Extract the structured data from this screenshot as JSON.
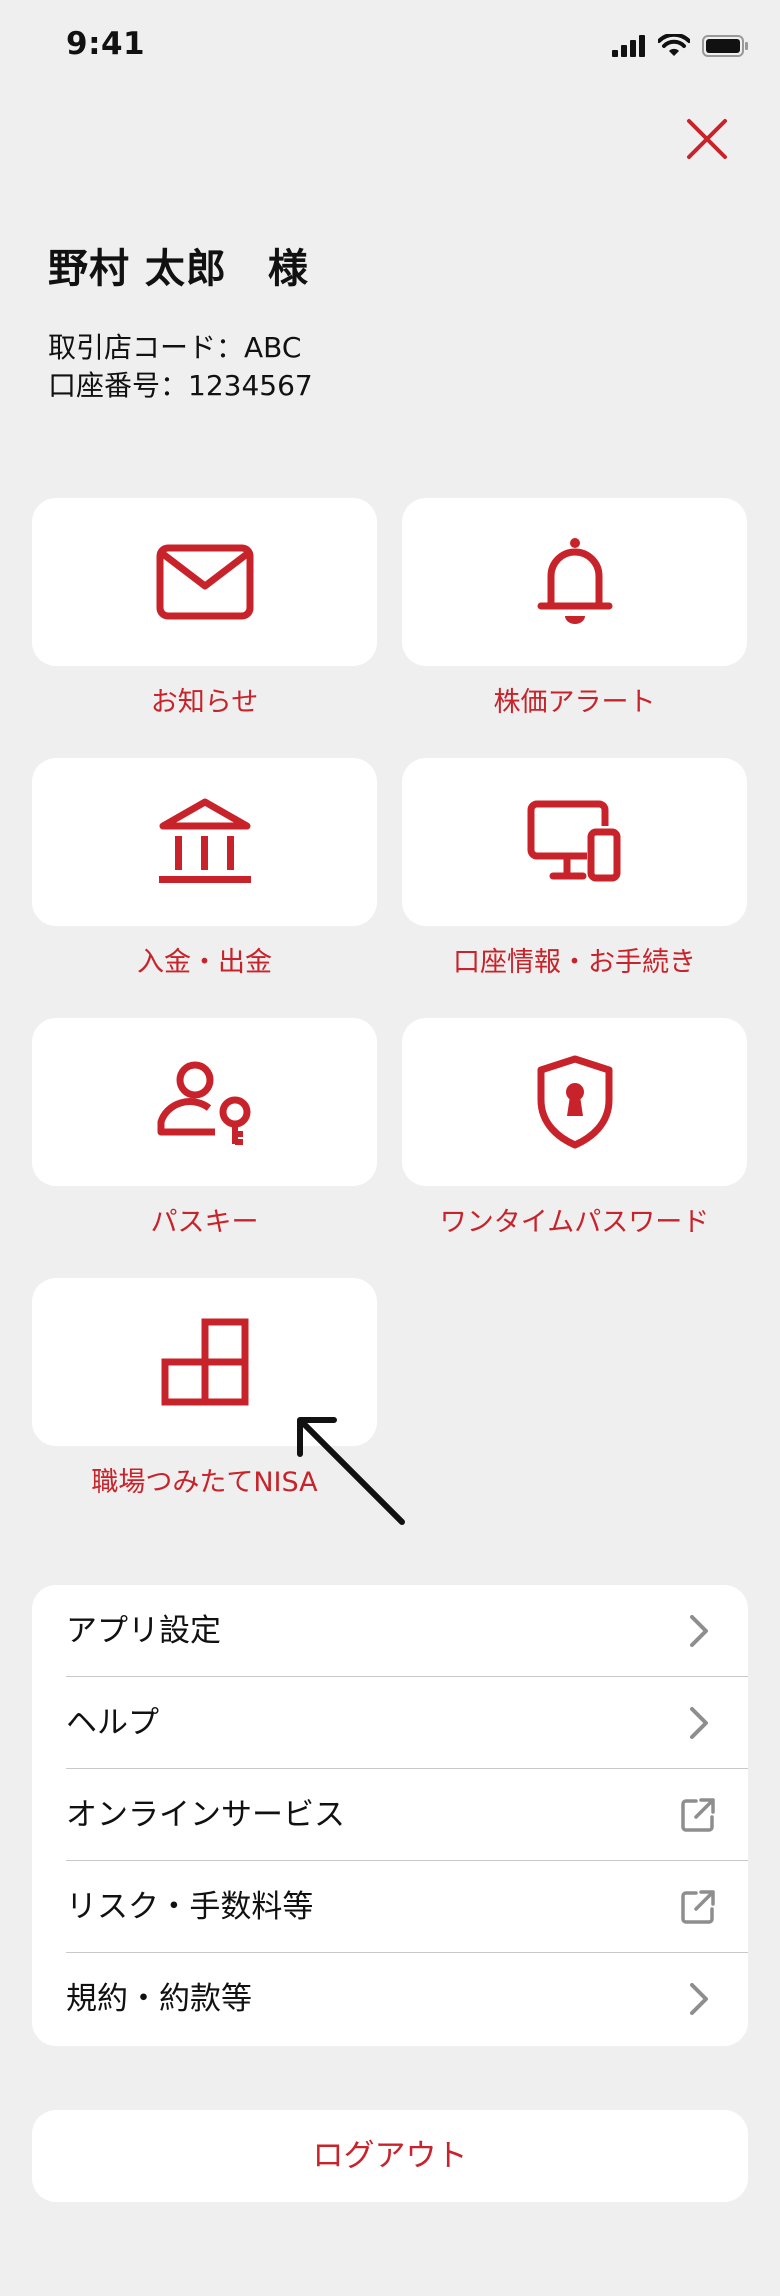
{
  "status": {
    "time": "9:41"
  },
  "user": {
    "name": "野村 太郎　様",
    "branch": "取引店コード：ABC",
    "account": "口座番号：1234567"
  },
  "tiles": [
    {
      "label": "お知らせ",
      "icon": "mail-icon"
    },
    {
      "label": "株価アラート",
      "icon": "bell-icon"
    },
    {
      "label": "入金・出金",
      "icon": "bank-icon"
    },
    {
      "label": "口座情報・お手続き",
      "icon": "devices-icon"
    },
    {
      "label": "パスキー",
      "icon": "user-key-icon"
    },
    {
      "label": "ワンタイムパスワード",
      "icon": "shield-keyhole-icon"
    },
    {
      "label": "職場つみたてNISA",
      "icon": "blocks-icon"
    }
  ],
  "menu": [
    {
      "label": "アプリ設定",
      "icon": "chevron-right-icon"
    },
    {
      "label": "ヘルプ",
      "icon": "chevron-right-icon"
    },
    {
      "label": "オンラインサービス",
      "icon": "external-link-icon"
    },
    {
      "label": "リスク・手数料等",
      "icon": "external-link-icon"
    },
    {
      "label": "規約・約款等",
      "icon": "chevron-right-icon"
    }
  ],
  "logout_label": "ログアウト",
  "colors": {
    "accent": "#c8232a",
    "background": "#efefef",
    "card": "#ffffff",
    "icon_gray": "#8e8e8e"
  }
}
